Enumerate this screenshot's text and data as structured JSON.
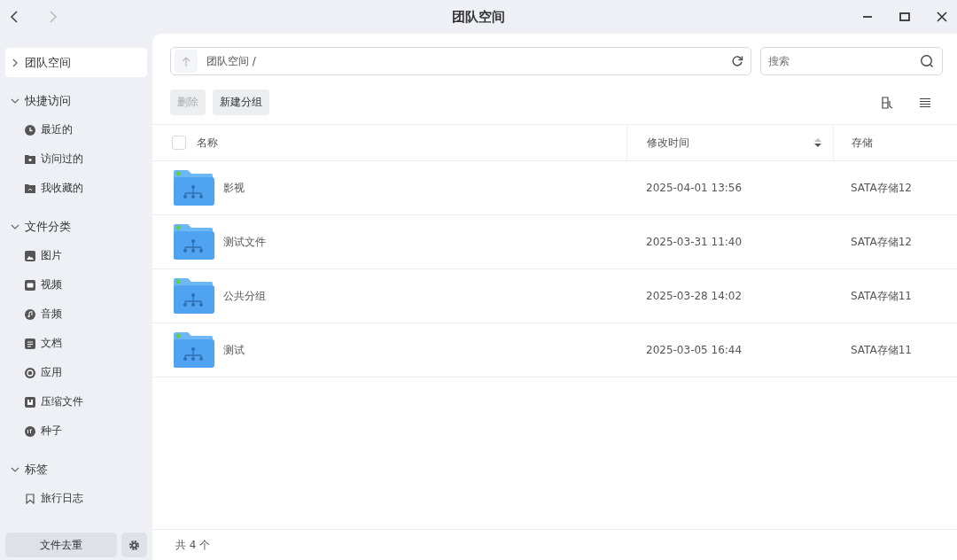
{
  "window": {
    "title": "团队空间"
  },
  "sidebar": {
    "sections": [
      {
        "label": "团队空间",
        "expanded": false,
        "selected": true
      },
      {
        "label": "快捷访问",
        "expanded": true,
        "selected": false,
        "items": [
          {
            "label": "最近的"
          },
          {
            "label": "访问过的"
          },
          {
            "label": "我收藏的"
          }
        ]
      },
      {
        "label": "文件分类",
        "expanded": true,
        "selected": false,
        "items": [
          {
            "label": "图片"
          },
          {
            "label": "视频"
          },
          {
            "label": "音频"
          },
          {
            "label": "文档"
          },
          {
            "label": "应用"
          },
          {
            "label": "压缩文件"
          },
          {
            "label": "种子"
          }
        ]
      },
      {
        "label": "标签",
        "expanded": true,
        "selected": false,
        "items": [
          {
            "label": "旅行日志"
          }
        ]
      }
    ],
    "dedupe_button": "文件去重"
  },
  "path_bar": {
    "path": "团队空间 /"
  },
  "search": {
    "placeholder": "搜索"
  },
  "toolbar": {
    "buttons": [
      {
        "label": "删除",
        "disabled": true
      },
      {
        "label": "新建分组",
        "disabled": false
      }
    ]
  },
  "table": {
    "select_all_checked": false,
    "columns": [
      "名称",
      "修改时间",
      "存储"
    ],
    "rows": [
      {
        "name": "影视",
        "modified": "2025-04-01 13:56",
        "storage": "SATA存储12"
      },
      {
        "name": "测试文件",
        "modified": "2025-03-31 11:40",
        "storage": "SATA存储12"
      },
      {
        "name": "公共分组",
        "modified": "2025-03-28 14:02",
        "storage": "SATA存储11"
      },
      {
        "name": "测试",
        "modified": "2025-03-05 16:44",
        "storage": "SATA存储11"
      }
    ]
  },
  "status_bar": {
    "count": "共 4 个"
  }
}
